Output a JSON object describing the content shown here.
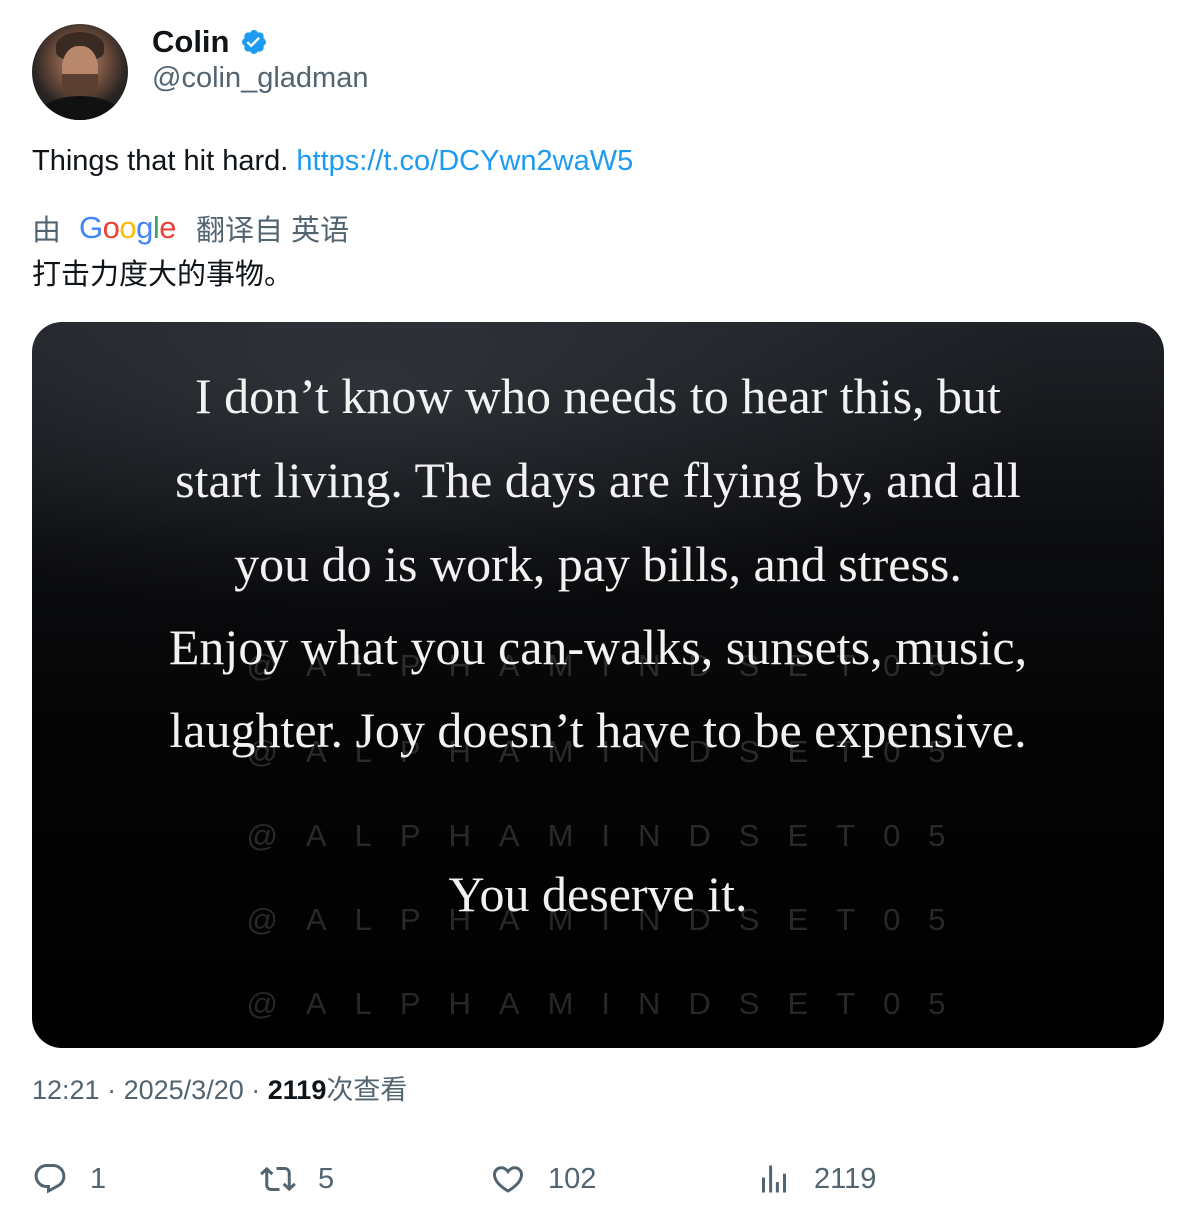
{
  "author": {
    "display_name": "Colin",
    "handle": "@colin_gladman",
    "verified": true
  },
  "tweet": {
    "text": "Things that hit hard.",
    "link": "https://t.co/DCYwn2waW5"
  },
  "translation": {
    "prefix": "由",
    "provider": "Google",
    "suffix": "翻译自 英语",
    "text": "打击力度大的事物。"
  },
  "media": {
    "watermark": "@ALPHAMINDSET05",
    "quote_lines": [
      "I don’t know who needs to hear this, but",
      "start living. The days are flying by, and all",
      "you do is work, pay bills, and stress.",
      "Enjoy what you can-walks, sunsets, music,",
      "laughter. Joy doesn’t have to be expensive.",
      "You deserve it."
    ]
  },
  "meta": {
    "time": "12:21",
    "separator": "·",
    "date": "2025/3/20",
    "views_count": "2119",
    "views_label": "次查看"
  },
  "actions": {
    "reply_count": "1",
    "retweet_count": "5",
    "like_count": "102",
    "views_count": "2119"
  },
  "colors": {
    "link": "#1d9bf0",
    "secondary_text": "#536471",
    "primary_text": "#0f1419",
    "verified_badge": "#1d9bf0"
  },
  "icons": [
    "verified-badge-icon",
    "reply-icon",
    "retweet-icon",
    "like-icon",
    "views-icon"
  ]
}
